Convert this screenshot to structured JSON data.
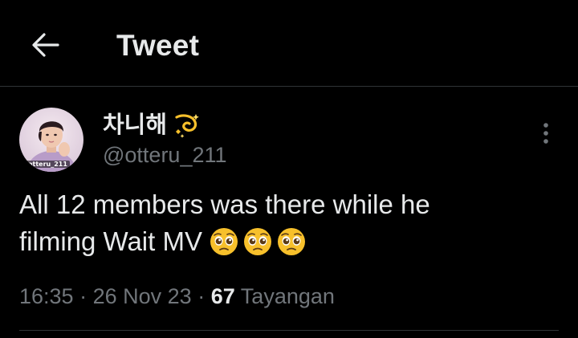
{
  "header": {
    "title": "Tweet",
    "back_icon": "arrow-left-icon"
  },
  "author": {
    "display_name": "차니해",
    "name_emoji": "dizzy-emoji",
    "handle": "@otteru_211",
    "avatar_watermark": "otteru_211"
  },
  "tweet": {
    "line1": "All 12 members was there while he",
    "line2": "filming Wait MV",
    "emojis": [
      "pleading-face-emoji",
      "pleading-face-emoji",
      "pleading-face-emoji"
    ]
  },
  "meta": {
    "time": "16:35",
    "separator": "·",
    "date": "26 Nov 23",
    "views_count": "67",
    "views_label": "Tayangan"
  },
  "colors": {
    "background": "#000000",
    "text_primary": "#e7e9ea",
    "text_secondary": "#71767b",
    "divider": "#2f3336",
    "emoji_yellow": "#f7c02b"
  }
}
